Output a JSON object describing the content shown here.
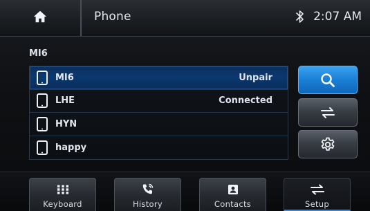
{
  "header": {
    "home_icon": "home-icon",
    "title": "Phone",
    "bluetooth_icon": "bluetooth-icon",
    "time": "2:07 AM"
  },
  "devices": {
    "header": "MI6",
    "items": [
      {
        "name": "MI6",
        "status": "Unpair",
        "selected": true,
        "icon": "phone-icon"
      },
      {
        "name": "LHE",
        "status": "Connected",
        "selected": false,
        "icon": "phone-icon"
      },
      {
        "name": "HYN",
        "status": "",
        "selected": false,
        "icon": "phone-icon"
      },
      {
        "name": "happy",
        "status": "",
        "selected": false,
        "icon": "phone-icon"
      }
    ]
  },
  "side_buttons": [
    {
      "icon": "search-icon",
      "accent": "#1b7fd6"
    },
    {
      "icon": "swap-arrows-icon"
    },
    {
      "icon": "gear-icon"
    }
  ],
  "bottom_nav": [
    {
      "label": "Keyboard",
      "icon": "keypad-icon"
    },
    {
      "label": "History",
      "icon": "call-history-icon"
    },
    {
      "label": "Contacts",
      "icon": "contacts-icon"
    },
    {
      "label": "Setup",
      "icon": "swap-arrows-icon",
      "active": true
    }
  ],
  "colors": {
    "accent": "#1b7fd6",
    "selected_row": "#0b386f"
  }
}
